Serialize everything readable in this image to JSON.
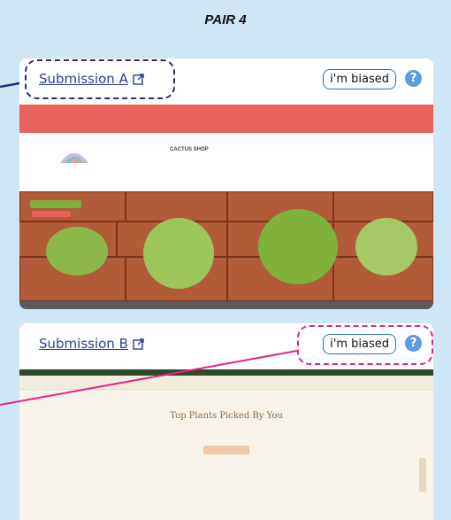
{
  "header": {
    "title": "PAIR 4"
  },
  "submission_a": {
    "link_label": "Submission A",
    "biased_button": "i'm biased",
    "help_label": "?",
    "preview": {
      "shop_name": "CACTUS SHOP"
    }
  },
  "submission_b": {
    "link_label": "Submission B",
    "biased_button": "i'm biased",
    "help_label": "?",
    "preview": {
      "heading": "Top Plants Picked By You"
    }
  },
  "colors": {
    "background": "#cfe6f4",
    "link": "#2f3d97",
    "annotation_a": "#262d73",
    "annotation_b": "#e0238c",
    "help_icon": "#5c9de0",
    "announcement_bar": "#e8615b"
  },
  "icons": [
    "external-link-icon",
    "help-icon"
  ]
}
